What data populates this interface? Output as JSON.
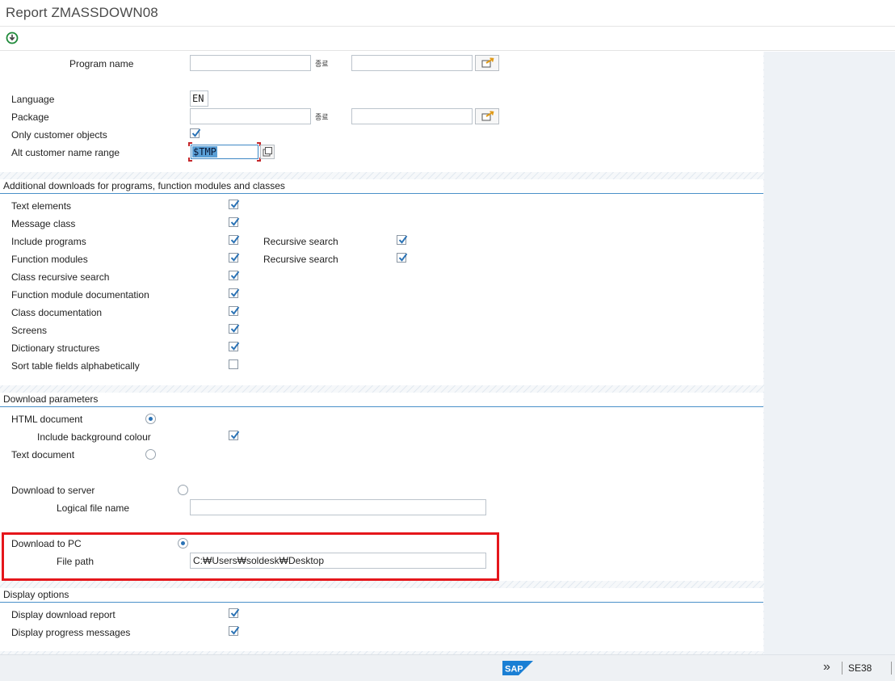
{
  "window": {
    "title": "Report ZMASSDOWN08"
  },
  "selection": {
    "program_name_label": "Program name",
    "program_from": "",
    "program_to_label": "종료",
    "program_to": "",
    "language_label": "Language",
    "language_value": "EN",
    "package_label": "Package",
    "package_from": "",
    "package_to_label": "종료",
    "package_to": "",
    "only_customer_label": "Only customer objects",
    "only_customer_checked": true,
    "alt_range_label": "Alt customer name range",
    "alt_range_value": "$TMP"
  },
  "additional": {
    "title": "Additional downloads for programs, function modules and classes",
    "items": [
      {
        "label": "Text elements",
        "checked": true
      },
      {
        "label": "Message class",
        "checked": true
      },
      {
        "label": "Include programs",
        "checked": true
      },
      {
        "label": "Function modules",
        "checked": true
      },
      {
        "label": "Class recursive search",
        "checked": true
      },
      {
        "label": "Function module documentation",
        "checked": true
      },
      {
        "label": "Class documentation",
        "checked": true
      },
      {
        "label": "Screens",
        "checked": true
      },
      {
        "label": "Dictionary structures",
        "checked": true
      },
      {
        "label": "Sort table fields alphabetically",
        "checked": false
      }
    ],
    "recursive": [
      {
        "label": "Recursive search",
        "checked": true
      },
      {
        "label": "Recursive search",
        "checked": true
      }
    ]
  },
  "download": {
    "title": "Download parameters",
    "html_label": "HTML document",
    "html_selected": true,
    "bg_colour_label": "Include background colour",
    "bg_colour_checked": true,
    "text_label": "Text document",
    "text_selected": false,
    "server_label": "Download to server",
    "server_selected": false,
    "logical_file_label": "Logical file name",
    "logical_file_value": "",
    "pc_label": "Download to PC",
    "pc_selected": true,
    "file_path_label": "File path",
    "file_path_value": "C:₩Users₩soldesk₩Desktop"
  },
  "display": {
    "title": "Display options",
    "report_label": "Display download report",
    "report_checked": true,
    "progress_label": "Display progress messages",
    "progress_checked": true
  },
  "status": {
    "transaction": "SE38",
    "logo_text": "SAP",
    "chevrons": "»"
  },
  "colors": {
    "accent": "#4a90c9",
    "highlight": "#e5161b",
    "check": "#2a72b5"
  }
}
